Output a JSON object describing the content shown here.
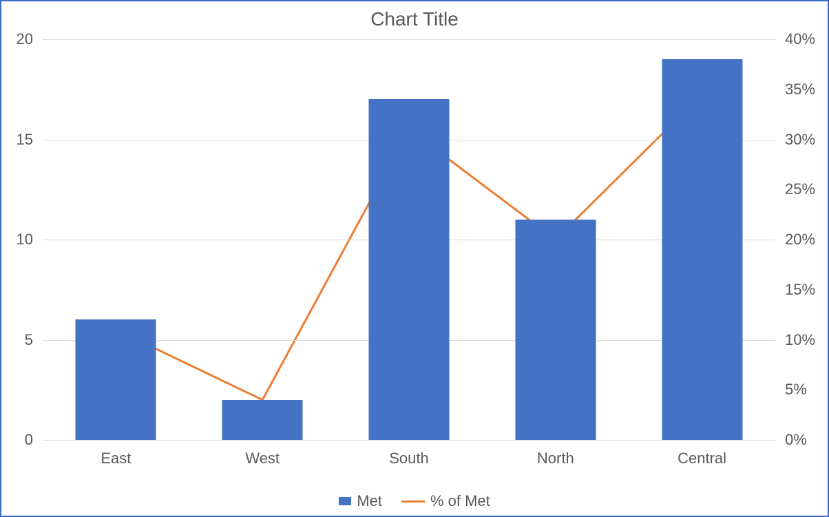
{
  "chart_data": {
    "type": "bar+line",
    "title": "Chart Title",
    "categories": [
      "East",
      "West",
      "South",
      "North",
      "Central"
    ],
    "series": [
      {
        "name": "Met",
        "kind": "bar",
        "axis": "left",
        "values": [
          6,
          2,
          17,
          11,
          19
        ],
        "color": "#4472c4"
      },
      {
        "name": "% of Met",
        "kind": "line",
        "axis": "right",
        "values": [
          11,
          4,
          31,
          20,
          34.5
        ],
        "color": "#ed7d31"
      }
    ],
    "left_axis": {
      "min": 0,
      "max": 20,
      "ticks": [
        0,
        5,
        10,
        15,
        20
      ]
    },
    "right_axis": {
      "min": 0,
      "max": 40,
      "ticks_pct": [
        0,
        5,
        10,
        15,
        20,
        25,
        30,
        35,
        40
      ]
    },
    "legend": [
      "Met",
      "% of Met"
    ]
  },
  "title": "Chart Title",
  "left_ticks": {
    "t0": "0",
    "t1": "5",
    "t2": "10",
    "t3": "15",
    "t4": "20"
  },
  "right_ticks": {
    "t0": "0%",
    "t1": "5%",
    "t2": "10%",
    "t3": "15%",
    "t4": "20%",
    "t5": "25%",
    "t6": "30%",
    "t7": "35%",
    "t8": "40%"
  },
  "cats": {
    "c0": "East",
    "c1": "West",
    "c2": "South",
    "c3": "North",
    "c4": "Central"
  },
  "legend_labels": {
    "bar": "Met",
    "line": "% of Met"
  }
}
